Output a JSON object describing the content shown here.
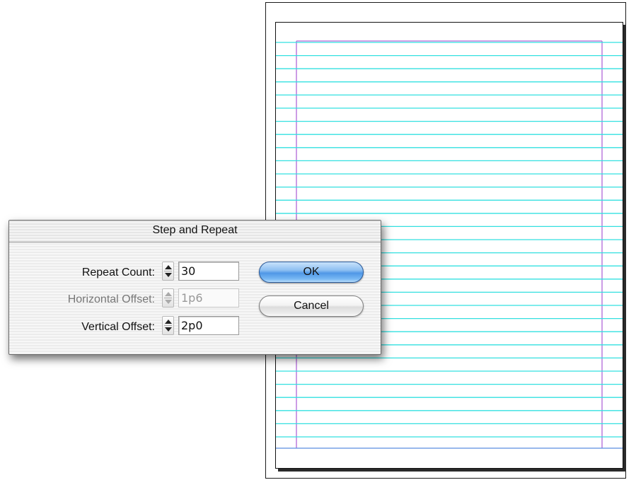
{
  "dialog": {
    "title": "Step and Repeat",
    "fields": [
      {
        "label": "Repeat Count:",
        "value": "30",
        "enabled": true
      },
      {
        "label": "Horizontal Offset:",
        "value": "1p6",
        "enabled": false
      },
      {
        "label": "Vertical Offset:",
        "value": "2p0",
        "enabled": true
      }
    ],
    "ok_label": "OK",
    "cancel_label": "Cancel"
  },
  "document": {
    "repeated_line_count": 30,
    "colors": {
      "guide_line": "#33e0e0",
      "margin_guide": "#b066d8",
      "bottom_guide": "#5a8ee0",
      "ok_button": "#5a9ee8"
    }
  }
}
